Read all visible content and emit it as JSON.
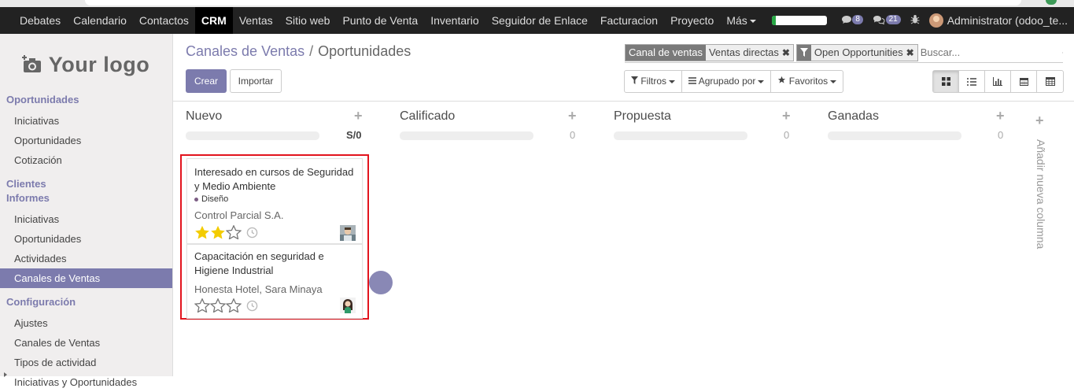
{
  "navbar": {
    "menu": [
      "Debates",
      "Calendario",
      "Contactos",
      "CRM",
      "Ventas",
      "Sitio web",
      "Punto de Venta",
      "Inventario",
      "Seguidor de Enlace",
      "Facturacion",
      "Proyecto",
      "Más"
    ],
    "active": "CRM",
    "progress_fraction": 0.08,
    "chat_count": "8",
    "activity_count": "21",
    "user": "Administrator (odoo_te..."
  },
  "logo": {
    "text": "Your logo"
  },
  "sidebar": {
    "sections": [
      {
        "head": "Oportunidades",
        "items": [
          "Iniciativas",
          "Oportunidades",
          "Cotización"
        ]
      },
      {
        "head": "Clientes",
        "items": []
      },
      {
        "head": "Informes",
        "items": [
          "Iniciativas",
          "Oportunidades",
          "Actividades",
          "Canales de Ventas"
        ]
      },
      {
        "head": "Configuración",
        "items": [
          "Ajustes",
          "Canales de Ventas",
          "Tipos de actividad",
          "Iniciativas y Oportunidades"
        ]
      }
    ],
    "active_item": "Canales de Ventas"
  },
  "breadcrumb": {
    "parent": "Canales de Ventas",
    "separator": "/",
    "current": "Oportunidades"
  },
  "buttons": {
    "create": "Crear",
    "import": "Importar"
  },
  "search": {
    "facet1_label": "Canal de ventas",
    "facet1_value": "Ventas directas",
    "facet2_value": "Open Opportunities",
    "placeholder": "Buscar..."
  },
  "filters": {
    "filters": "Filtros",
    "group_by": "Agrupado por",
    "favorites": "Favoritos"
  },
  "views": [
    "kanban-icon",
    "list-icon",
    "graph-icon",
    "calendar-icon",
    "pivot-icon"
  ],
  "kanban": {
    "columns": [
      {
        "title": "Nuevo",
        "count": "S/0"
      },
      {
        "title": "Calificado",
        "count": "0"
      },
      {
        "title": "Propuesta",
        "count": "0"
      },
      {
        "title": "Ganadas",
        "count": "0"
      }
    ],
    "add_column": "Añadir nueva columna",
    "cards": [
      {
        "title": "Interesado en cursos de Seguridad y Medio Ambiente",
        "tag": "Diseño",
        "partner": "Control Parcial S.A.",
        "stars": 2
      },
      {
        "title": "Capacitación en seguridad e Higiene Industrial",
        "tag": "",
        "partner": "Honesta Hotel, Sara Minaya",
        "stars": 0
      }
    ]
  },
  "colors": {
    "brand": "#7c7bad",
    "navbar": "#222222",
    "highlight_border": "#e2141e",
    "star": "#f3cc00"
  }
}
